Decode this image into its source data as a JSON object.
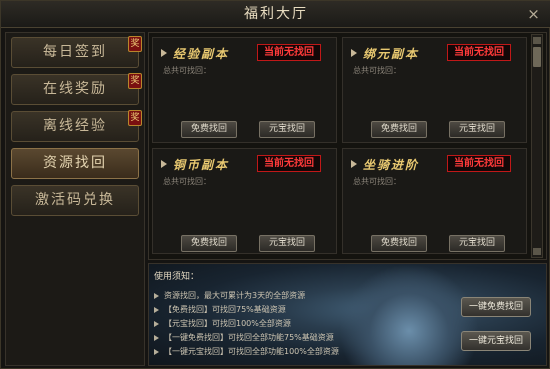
{
  "window": {
    "title": "福利大厅",
    "close_icon": "×"
  },
  "sidebar": {
    "badge": "奖",
    "items": [
      {
        "label": "每日签到",
        "badge": true
      },
      {
        "label": "在线奖励",
        "badge": true
      },
      {
        "label": "离线经验",
        "badge": true
      },
      {
        "label": "资源找回",
        "badge": false,
        "active": true
      },
      {
        "label": "激活码兑换",
        "badge": false
      }
    ]
  },
  "cards": [
    {
      "title": "经验副本",
      "status": "当前无找回",
      "recover_label": "总共可找回：",
      "free_button": "免费找回",
      "gold_button": "元宝找回"
    },
    {
      "title": "绑元副本",
      "status": "当前无找回",
      "recover_label": "总共可找回：",
      "free_button": "免费找回",
      "gold_button": "元宝找回"
    },
    {
      "title": "铜币副本",
      "status": "当前无找回",
      "recover_label": "总共可找回：",
      "free_button": "免费找回",
      "gold_button": "元宝找回"
    },
    {
      "title": "坐骑进阶",
      "status": "当前无找回",
      "recover_label": "总共可找回：",
      "free_button": "免费找回",
      "gold_button": "元宝找回"
    }
  ],
  "notice": {
    "title": "使用须知：",
    "rules": [
      "资源找回，最大可累计为3天的全部资源",
      "【免费找回】可找回75%基础资源",
      "【元宝找回】可找回100%全部资源",
      "【一键免费找回】可找回全部功能75%基础资源",
      "【一键元宝找回】可找回全部功能100%全部资源"
    ],
    "free_all_button": "一键免费找回",
    "gold_all_button": "一键元宝找回"
  }
}
